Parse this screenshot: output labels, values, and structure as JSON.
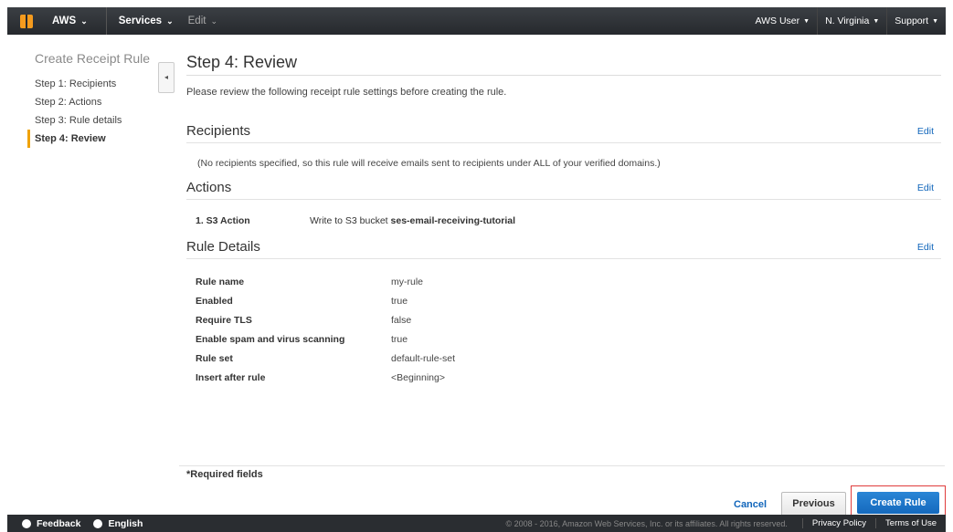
{
  "topbar": {
    "brand": "AWS",
    "services": "Services",
    "edit": "Edit",
    "user": "AWS User",
    "region": "N. Virginia",
    "support": "Support"
  },
  "sidebar": {
    "title": "Create Receipt Rule",
    "steps": [
      {
        "label": "Step 1: Recipients",
        "active": false
      },
      {
        "label": "Step 2: Actions",
        "active": false
      },
      {
        "label": "Step 3: Rule details",
        "active": false
      },
      {
        "label": "Step 4: Review",
        "active": true
      }
    ],
    "collapse_glyph": "◂"
  },
  "main": {
    "title": "Step 4: Review",
    "intro": "Please review the following receipt rule settings before creating the rule.",
    "recipients": {
      "heading": "Recipients",
      "edit": "Edit",
      "note": "(No recipients specified, so this rule will receive emails sent to recipients under ALL of your verified domains.)"
    },
    "actions": {
      "heading": "Actions",
      "edit": "Edit",
      "items": [
        {
          "label": "1. S3 Action",
          "text": "Write to S3 bucket ",
          "bucket": "ses-email-receiving-tutorial"
        }
      ]
    },
    "details": {
      "heading": "Rule Details",
      "edit": "Edit",
      "rows": [
        {
          "key": "Rule name",
          "value": "my-rule"
        },
        {
          "key": "Enabled",
          "value": "true"
        },
        {
          "key": "Require TLS",
          "value": "false"
        },
        {
          "key": "Enable spam and virus scanning",
          "value": "true"
        },
        {
          "key": "Rule set",
          "value": "default-rule-set"
        },
        {
          "key": "Insert after rule",
          "value": "<Beginning>"
        }
      ]
    }
  },
  "footer": {
    "required": "*Required fields",
    "cancel": "Cancel",
    "previous": "Previous",
    "create": "Create Rule"
  },
  "bottombar": {
    "feedback": "Feedback",
    "language": "English",
    "copyright": "© 2008 - 2016, Amazon Web Services, Inc. or its affiliates. All rights reserved.",
    "privacy": "Privacy Policy",
    "terms": "Terms of Use"
  },
  "colors": {
    "accent": "#1569bd",
    "active_step": "#f0a30a",
    "highlight": "#e03c3c"
  }
}
